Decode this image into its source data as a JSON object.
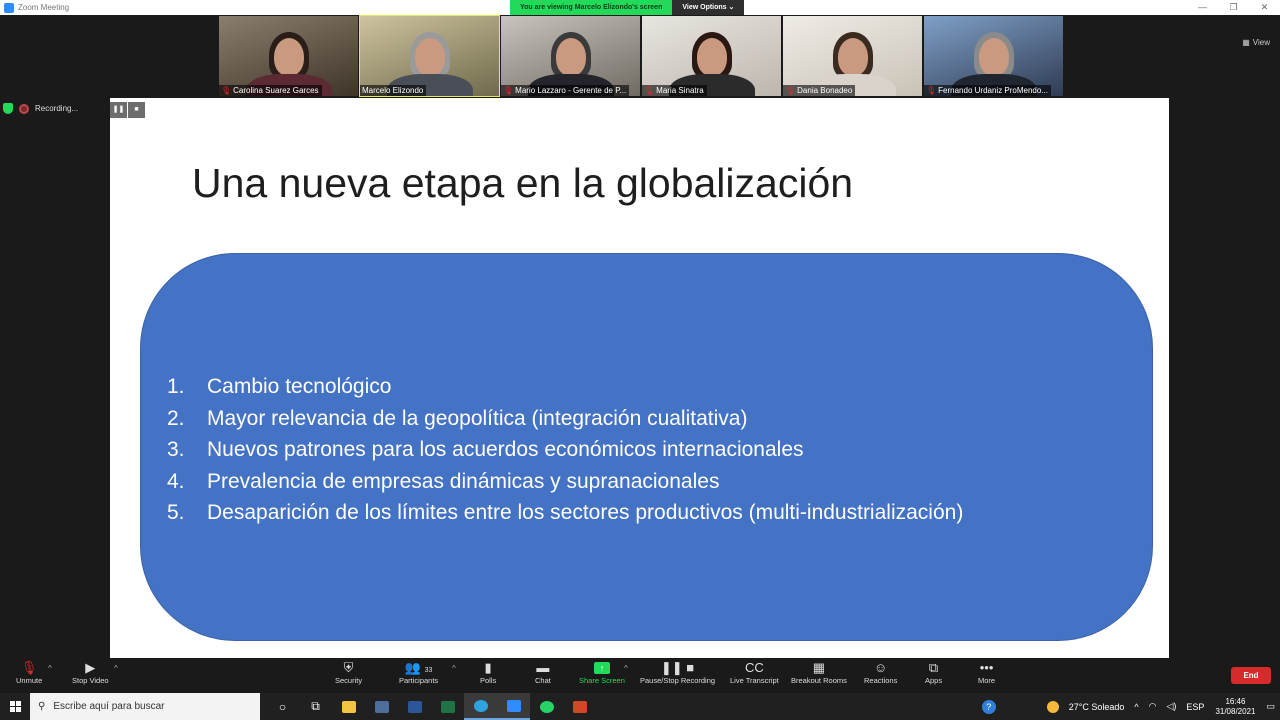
{
  "window": {
    "title": "Zoom Meeting",
    "controls": [
      "—",
      "❐",
      "✕"
    ]
  },
  "banner": {
    "viewing": "You are viewing Marcelo Elizondo's screen",
    "options": "View Options ⌄"
  },
  "view_label": "View",
  "participants": [
    {
      "name": "Carolina Suarez Garces",
      "muted": true
    },
    {
      "name": "Marcelo Elizondo",
      "muted": false
    },
    {
      "name": "Mario Lazzaro - Gerente de P...",
      "muted": true
    },
    {
      "name": "Maria Sinatra",
      "muted": true
    },
    {
      "name": "Dania Bonadeo",
      "muted": true
    },
    {
      "name": "Fernando Urdaniz ProMendo...",
      "muted": true
    }
  ],
  "recording": {
    "label": "Recording...",
    "pause": "❚❚",
    "stop": "■"
  },
  "slide": {
    "title": "Una nueva etapa en la globalización",
    "points": [
      {
        "num": "1.",
        "text": "Cambio tecnológico"
      },
      {
        "num": "2.",
        "text": "Mayor relevancia de la geopolítica (integración cualitativa)"
      },
      {
        "num": "3.",
        "text": "Nuevos patrones para los acuerdos económicos internacionales"
      },
      {
        "num": "4.",
        "text": "Prevalencia de empresas dinámicas y supranacionales"
      },
      {
        "num": "5.",
        "text": "Desaparición de los límites entre los sectores productivos (multi-industrialización)"
      }
    ]
  },
  "toolbar": {
    "unmute": "Unmute",
    "stop_video": "Stop Video",
    "security": "Security",
    "participants": "Participants",
    "participants_count": "33",
    "polls": "Polls",
    "chat": "Chat",
    "share_screen": "Share Screen",
    "pause_recording": "Pause/Stop Recording",
    "live_transcript": "Live Transcript",
    "breakout_rooms": "Breakout Rooms",
    "reactions": "Reactions",
    "apps": "Apps",
    "more": "More",
    "end": "End"
  },
  "taskbar": {
    "search_placeholder": "Escribe aquí para buscar",
    "weather": "27°C  Soleado",
    "lang": "ESP",
    "time": "16:46",
    "date": "31/08/2021"
  },
  "colors": {
    "slide_box": "#4472c4",
    "share_green": "#23d959",
    "end_red": "#d52b2b"
  }
}
